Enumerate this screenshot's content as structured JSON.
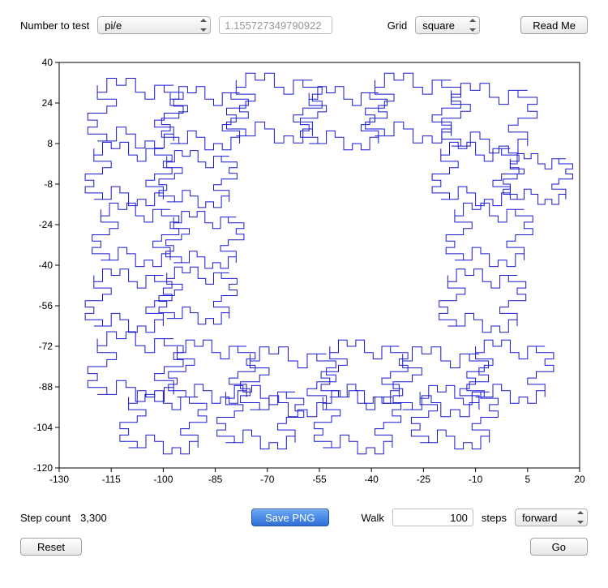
{
  "top": {
    "number_label": "Number to test",
    "number_selected": "pi/e",
    "number_value": "1.155727349790922",
    "grid_label": "Grid",
    "grid_selected": "square",
    "readme_label": "Read Me"
  },
  "chart_data": {
    "type": "line",
    "title": "",
    "xlabel": "",
    "ylabel": "",
    "xlim": [
      -130,
      20
    ],
    "ylim": [
      -120,
      40
    ],
    "xticks": [
      -130,
      -115,
      -100,
      -85,
      -70,
      -55,
      -40,
      -25,
      -10,
      5,
      20
    ],
    "yticks": [
      -120,
      -104,
      -88,
      -72,
      -56,
      -40,
      -24,
      -8,
      8,
      24,
      40
    ],
    "description": "Fractal random-walk path on square grid, blue line, forming repeating jigsaw-like outline pattern tiled in a rough rectangular ring."
  },
  "bottom": {
    "step_label": "Step count",
    "step_value": "3,300",
    "save_label": "Save PNG",
    "walk_label": "Walk",
    "walk_value": "100",
    "steps_label": "steps",
    "direction_selected": "forward",
    "reset_label": "Reset",
    "go_label": "Go"
  }
}
